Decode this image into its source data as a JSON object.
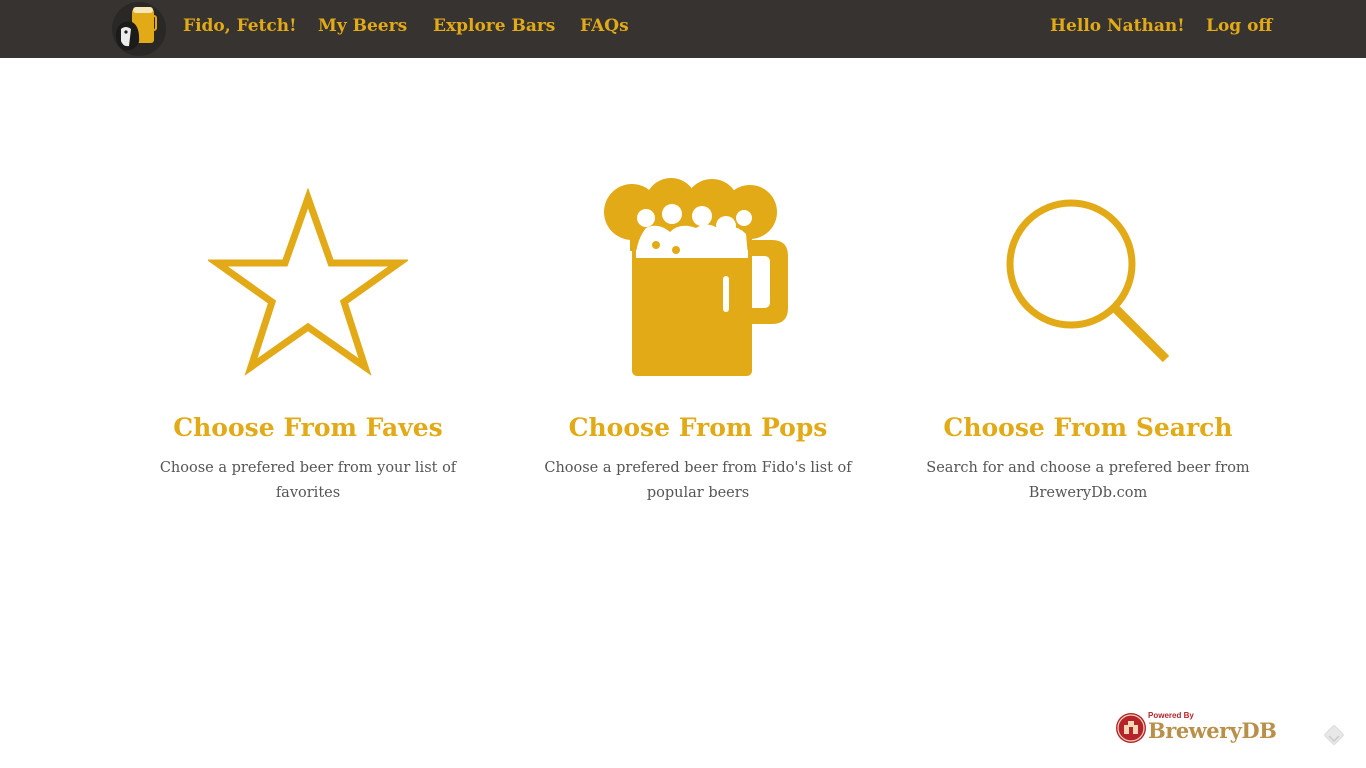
{
  "nav": {
    "brand_logo_icon": "beer-dog-logo-icon",
    "brand": "Fido, Fetch!",
    "links": [
      {
        "label": "My Beers"
      },
      {
        "label": "Explore Bars"
      },
      {
        "label": "FAQs"
      }
    ],
    "greeting": "Hello Nathan!",
    "logoff": "Log off"
  },
  "features": [
    {
      "icon": "star-icon",
      "title": "Choose From Faves",
      "description": "Choose a prefered beer from your list of favorites"
    },
    {
      "icon": "beer-mug-icon",
      "title": "Choose From Pops",
      "description": "Choose a prefered beer from Fido's list of popular beers"
    },
    {
      "icon": "search-icon",
      "title": "Choose From Search",
      "description": "Search for and choose a prefered beer from BreweryDb.com"
    }
  ],
  "footer": {
    "powered_by": "Powered By",
    "brewerydb": "BreweryDB",
    "corner_icon": "feedback-icon"
  },
  "colors": {
    "navbar_bg": "#363330",
    "accent": "#e3aa17",
    "body_text": "#555555",
    "brewerydb_red": "#b5242a",
    "brewerydb_tan": "#b8904a"
  }
}
